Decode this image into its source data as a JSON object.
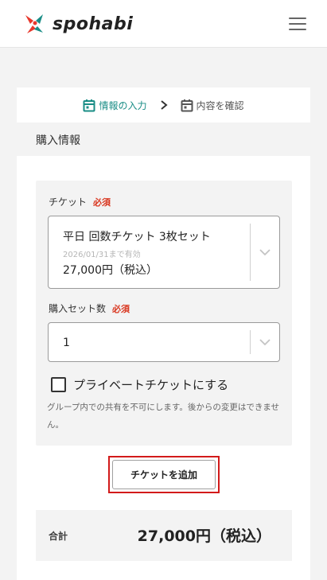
{
  "header": {
    "brand": "spohabi",
    "logo_icon": "spohabi-logo-icon",
    "menu_icon": "hamburger-menu-icon",
    "brand_colors": {
      "red": "#e8382c",
      "teal": "#1a8d86"
    }
  },
  "steps": {
    "items": [
      {
        "label": "情報の入力",
        "icon": "calendar-icon",
        "active": true
      },
      {
        "label": "内容を確認",
        "icon": "calendar-icon",
        "active": false
      }
    ],
    "separator_icon": "chevron-right-icon",
    "active_color": "#1a8d86"
  },
  "section_title": "購入情報",
  "form": {
    "ticket": {
      "label": "チケット",
      "required": "必須",
      "selected": {
        "name": "平日 回数チケット 3枚セット",
        "valid_until": "2026/01/31まで有効",
        "price": "27,000円（税込）"
      },
      "dropdown_icon": "chevron-down-icon"
    },
    "quantity": {
      "label": "購入セット数",
      "required": "必須",
      "value": "1",
      "dropdown_icon": "chevron-down-icon"
    },
    "private_checkbox": {
      "label": "プライベートチケットにする",
      "checked": false,
      "note": "グループ内での共有を不可にします。後からの変更はできません。"
    },
    "add_ticket_button": "チケットを追加",
    "required_color": "#d9361f",
    "highlight_color": "#d21a1a"
  },
  "total": {
    "label": "合計",
    "value": "27,000円（税込）"
  }
}
